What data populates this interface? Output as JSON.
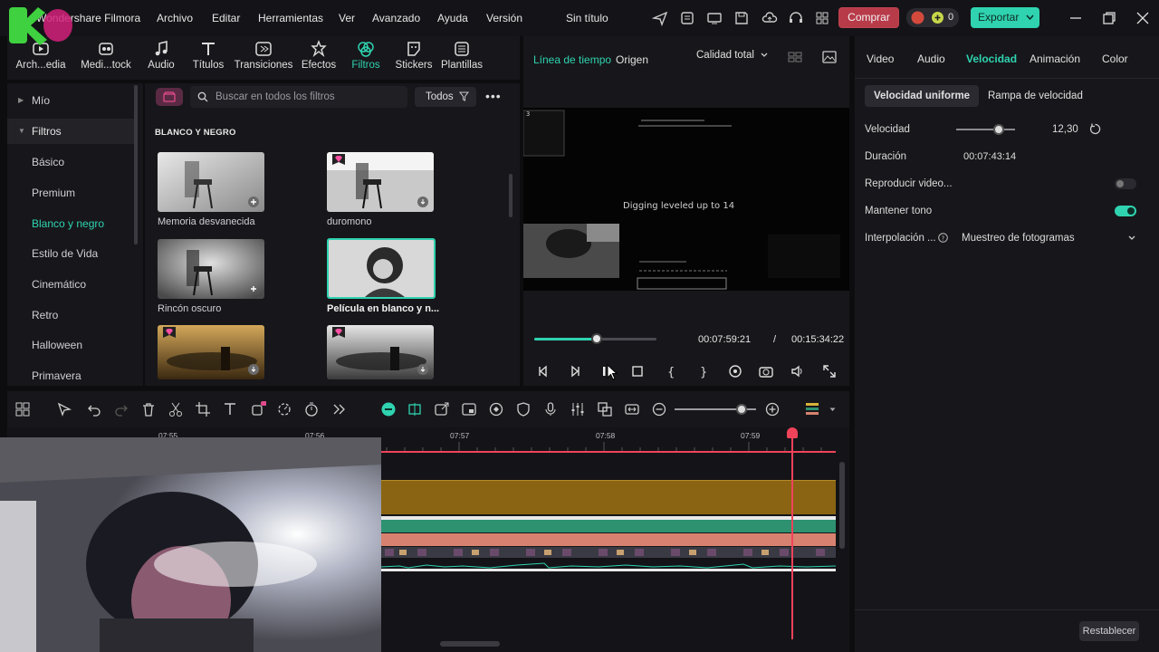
{
  "app": {
    "name": "Wondershare Filmora",
    "project_title": "Sin título",
    "menu": [
      "Archivo",
      "Editar",
      "Herramientas",
      "Ver",
      "Avanzado",
      "Ayuda",
      "Versión"
    ],
    "buy_label": "Comprar",
    "credits_count": "0",
    "export_label": "Exportar"
  },
  "library": {
    "tabs": [
      {
        "label": "Arch...edia",
        "icon": "media-icon"
      },
      {
        "label": "Medi...tock",
        "icon": "stock-icon"
      },
      {
        "label": "Audio",
        "icon": "music-note-icon"
      },
      {
        "label": "Títulos",
        "icon": "text-icon"
      },
      {
        "label": "Transiciones",
        "icon": "transition-icon"
      },
      {
        "label": "Efectos",
        "icon": "effects-icon"
      },
      {
        "label": "Filtros",
        "icon": "filter-icon"
      },
      {
        "label": "Stickers",
        "icon": "sticker-icon"
      },
      {
        "label": "Plantillas",
        "icon": "template-icon"
      }
    ],
    "active_tab": "Filtros",
    "nav": {
      "mine": "Mío",
      "filters_group": "Filtros",
      "items": [
        "Básico",
        "Premium",
        "Blanco y negro",
        "Estilo de Vida",
        "Cinemático",
        "Retro",
        "Halloween",
        "Primavera"
      ],
      "selected": "Blanco y negro"
    },
    "search_placeholder": "Buscar en todos los filtros",
    "filter_dropdown": "Todos",
    "section_title": "BLANCO Y NEGRO",
    "thumbnails": [
      {
        "label": "Memoria desvanecida",
        "premium": false
      },
      {
        "label": "duromono",
        "premium": true
      },
      {
        "label": "Rincón oscuro",
        "premium": false
      },
      {
        "label": "Película en blanco y n...",
        "premium": false,
        "selected": true
      },
      {
        "label": "",
        "premium": true
      },
      {
        "label": "",
        "premium": true
      }
    ]
  },
  "player": {
    "tabs": [
      "Línea de tiempo",
      "Origen"
    ],
    "active_tab": "Línea de tiempo",
    "quality": "Calidad total",
    "overlay_text": "Digging leveled up to 14",
    "current_time": "00:07:59:21",
    "separator": "/",
    "total_time": "00:15:34:22",
    "progress_fraction": 0.51
  },
  "properties": {
    "tabs": [
      "Video",
      "Audio",
      "Velocidad",
      "Animación",
      "Color"
    ],
    "active_tab": "Velocidad",
    "segments": [
      "Velocidad uniforme",
      "Rampa de velocidad"
    ],
    "active_segment": "Velocidad uniforme",
    "speed_label": "Velocidad",
    "speed_value": "12,30",
    "speed_fraction": 0.72,
    "duration_label": "Duración",
    "duration_value": "00:07:43:14",
    "reverse_label": "Reproducir video...",
    "reverse_on": false,
    "keep_pitch_label": "Mantener tono",
    "keep_pitch_on": true,
    "interp_label": "Interpolación ...",
    "interp_value": "Muestreo de fotogramas",
    "reset_label": "Restablecer"
  },
  "timeline": {
    "ruler": [
      "07:55",
      "07:56",
      "07:57",
      "07:58",
      "07:59"
    ],
    "zoom_fraction": 0.82
  },
  "colors": {
    "accent": "#2fd3b0",
    "playhead": "#f0435a",
    "buy": "#b83b4a",
    "audio_clip": "#8a6412",
    "teal_track": "#2e9270",
    "salmon_track": "#d78270"
  }
}
